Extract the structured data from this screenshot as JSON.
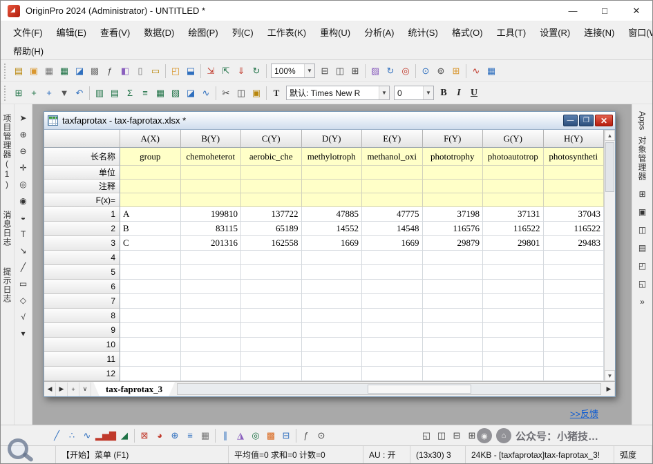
{
  "window": {
    "title": "OriginPro 2024 (Administrator) - UNTITLED *",
    "controls": {
      "minimize": "—",
      "maximize": "□",
      "close": "✕"
    }
  },
  "menubar": {
    "row1": [
      "文件(F)",
      "编辑(E)",
      "查看(V)",
      "数据(D)",
      "绘图(P)",
      "列(C)",
      "工作表(K)",
      "重构(U)",
      "分析(A)",
      "统计(S)",
      "格式(O)",
      "工具(T)",
      "设置(R)",
      "连接(N)",
      "窗口(W)"
    ],
    "row2": [
      "帮助(H)"
    ]
  },
  "toolbar": {
    "zoom": "100%",
    "font_tool": "T",
    "font_label": "默认: Times New R",
    "font_size": "0",
    "bold": "B",
    "italic": "I",
    "underline": "U",
    "dropdown_arrow": "▼"
  },
  "toolbar_icons": {
    "row1a": [
      {
        "n": "new-project",
        "g": "▤",
        "c": "#b8860b"
      },
      {
        "n": "new-folder",
        "g": "▣",
        "c": "#d9972f"
      },
      {
        "n": "new-workbook",
        "g": "▦",
        "c": "#777777"
      },
      {
        "n": "new-excel",
        "g": "▦",
        "c": "#1e7145"
      },
      {
        "n": "new-graph",
        "g": "◪",
        "c": "#2f6fbe"
      },
      {
        "n": "new-matrix",
        "g": "▩",
        "c": "#777777"
      },
      {
        "n": "new-function-plot",
        "g": "ƒ",
        "c": "#555555"
      },
      {
        "n": "new-3d-graph",
        "g": "◧",
        "c": "#8a5fbe"
      },
      {
        "n": "new-layout",
        "g": "▯",
        "c": "#777777"
      },
      {
        "n": "new-notes",
        "g": "▭",
        "c": "#b8860b"
      },
      "|",
      {
        "n": "open",
        "g": "◰",
        "c": "#d9972f"
      },
      {
        "n": "save-project",
        "g": "⬓",
        "c": "#2f6fbe"
      },
      "|",
      {
        "n": "import-wizard",
        "g": "⇲",
        "c": "#c0392b"
      },
      {
        "n": "import-excel",
        "g": "⇱",
        "c": "#1e7145"
      },
      {
        "n": "import-ascii",
        "g": "⇓",
        "c": "#c0392b"
      },
      {
        "n": "recalculate",
        "g": "↻",
        "c": "#1e7145"
      },
      "|"
    ],
    "row1b": [
      {
        "n": "print",
        "g": "⊟",
        "c": "#444444"
      },
      {
        "n": "copy-graph",
        "g": "◫",
        "c": "#444444"
      },
      {
        "n": "duplicate-window",
        "g": "⊞",
        "c": "#444444"
      },
      "|",
      {
        "n": "color-manager",
        "g": "▨",
        "c": "#8a5fbe"
      },
      {
        "n": "refresh-graph",
        "g": "↻",
        "c": "#2f6fbe"
      },
      {
        "n": "snap-center",
        "g": "◎",
        "c": "#c0392b"
      },
      "|",
      {
        "n": "find",
        "g": "⊙",
        "c": "#2f6fbe"
      },
      {
        "n": "search-apps",
        "g": "⊚",
        "c": "#444444"
      },
      {
        "n": "app-center",
        "g": "⊞",
        "c": "#d9972f"
      },
      "|",
      {
        "n": "fitting-gallery",
        "g": "∿",
        "c": "#c0392b"
      },
      {
        "n": "graph-gallery",
        "g": "▦",
        "c": "#2f6fbe"
      }
    ],
    "row2a": [
      {
        "n": "add-workbook",
        "g": "⊞",
        "c": "#1e7145"
      },
      {
        "n": "add-columns",
        "g": "+",
        "c": "#1e7145"
      },
      {
        "n": "add-rows",
        "g": "+",
        "c": "#2f6fbe"
      },
      {
        "n": "pin-window",
        "g": "▼",
        "c": "#555555"
      },
      {
        "n": "undo",
        "g": "↶",
        "c": "#2f6fbe"
      },
      "|",
      {
        "n": "merge-cells",
        "g": "▥",
        "c": "#1e7145"
      },
      {
        "n": "set-values",
        "g": "▤",
        "c": "#1e7145"
      },
      {
        "n": "column-statistics",
        "g": "Σ",
        "c": "#1e7145"
      },
      {
        "n": "sort",
        "g": "≡",
        "c": "#1e7145"
      },
      {
        "n": "pivot-table",
        "g": "▦",
        "c": "#1e7145"
      },
      {
        "n": "freeze-panes",
        "g": "▧",
        "c": "#1e7145"
      },
      {
        "n": "insert-graph",
        "g": "◪",
        "c": "#2f6fbe"
      },
      {
        "n": "insert-sparkline",
        "g": "∿",
        "c": "#2f6fbe"
      },
      "|",
      {
        "n": "cut",
        "g": "✂",
        "c": "#444444"
      },
      {
        "n": "copy",
        "g": "◫",
        "c": "#444444"
      },
      {
        "n": "paste",
        "g": "▣",
        "c": "#b8860b"
      },
      "|"
    ]
  },
  "left_tabs": [
    "项目管理器(1)",
    "消息日志",
    "提示日志"
  ],
  "left_tools": [
    {
      "n": "pointer-tool",
      "g": "➤"
    },
    {
      "n": "zoom-in-tool",
      "g": "⊕"
    },
    {
      "n": "zoom-out-tool",
      "g": "⊖"
    },
    {
      "n": "screen-reader-tool",
      "g": "✛"
    },
    {
      "n": "data-reader-tool",
      "g": "◎"
    },
    {
      "n": "data-selector-tool",
      "g": "◉"
    },
    {
      "n": "mask-tool",
      "g": "◒"
    },
    {
      "n": "text-tool",
      "g": "T"
    },
    {
      "n": "arrow-tool",
      "g": "↘"
    },
    {
      "n": "line-tool",
      "g": "╱"
    },
    {
      "n": "rectangle-tool",
      "g": "▭"
    },
    {
      "n": "pan-tool",
      "g": "◇"
    },
    {
      "n": "equation-tool",
      "g": "√"
    },
    {
      "n": "more-tools",
      "g": "▾"
    }
  ],
  "right_panel": {
    "apps_label": "Apps",
    "object_manager_label": "对象管理器",
    "icons": [
      {
        "n": "apps-grid",
        "g": "⊞"
      },
      {
        "n": "mini-toolbar",
        "g": "▣"
      },
      {
        "n": "graph-browser",
        "g": "◫"
      },
      {
        "n": "worksheet-navigator",
        "g": "▤"
      },
      {
        "n": "float-panel",
        "g": "◰"
      },
      {
        "n": "dock-panel",
        "g": "◱"
      },
      {
        "n": "collapse-panel",
        "g": "»"
      }
    ]
  },
  "sheet": {
    "title": "taxfaprotax - tax-faprotax.xlsx *",
    "controls": {
      "minimize": "—",
      "restore": "❐",
      "close": "✕"
    },
    "columns": [
      "A(X)",
      "B(Y)",
      "C(Y)",
      "D(Y)",
      "E(Y)",
      "F(Y)",
      "G(Y)",
      "H(Y)"
    ],
    "label_rows": [
      {
        "label": "长名称",
        "values": [
          "group",
          "chemoheterot",
          "aerobic_che",
          "methylotroph",
          "methanol_oxi",
          "phototrophy",
          "photoautotrop",
          "photosyntheti"
        ]
      },
      {
        "label": "单位",
        "values": []
      },
      {
        "label": "注释",
        "values": []
      },
      {
        "label": "F(x)=",
        "values": []
      }
    ],
    "rows": [
      {
        "n": "1",
        "values": [
          "A",
          "199810",
          "137722",
          "47885",
          "47775",
          "37198",
          "37131",
          "37043"
        ]
      },
      {
        "n": "2",
        "values": [
          "B",
          "83115",
          "65189",
          "14552",
          "14548",
          "116576",
          "116522",
          "116522"
        ]
      },
      {
        "n": "3",
        "values": [
          "C",
          "201316",
          "162558",
          "1669",
          "1669",
          "29879",
          "29801",
          "29483"
        ]
      },
      {
        "n": "4",
        "values": []
      },
      {
        "n": "5",
        "values": []
      },
      {
        "n": "6",
        "values": []
      },
      {
        "n": "7",
        "values": []
      },
      {
        "n": "8",
        "values": []
      },
      {
        "n": "9",
        "values": []
      },
      {
        "n": "10",
        "values": []
      },
      {
        "n": "11",
        "values": []
      },
      {
        "n": "12",
        "values": []
      }
    ],
    "nav": [
      {
        "n": "prev-sheet",
        "g": "◀"
      },
      {
        "n": "next-sheet",
        "g": "▶"
      },
      {
        "n": "add-sheet",
        "g": "+"
      },
      {
        "n": "sheet-list",
        "g": "∨"
      }
    ],
    "tab": "tax-faprotax_3",
    "scroll_up": "▲",
    "scroll_down": "▼",
    "scroll_right": "▶"
  },
  "feedback": ">>反馈",
  "plot_toolbar": {
    "icons": [
      {
        "n": "line-plot",
        "g": "╱",
        "c": "#2f6fbe"
      },
      {
        "n": "scatter-plot",
        "g": "∴",
        "c": "#2f6fbe"
      },
      {
        "n": "line-symbol-plot",
        "g": "∿",
        "c": "#2f6fbe"
      },
      {
        "n": "column-plot",
        "g": "▂▅▇",
        "c": "#c0392b"
      },
      {
        "n": "area-plot",
        "g": "◢",
        "c": "#1e7145"
      },
      "|",
      {
        "n": "template-library",
        "g": "⊠",
        "c": "#c0392b"
      },
      {
        "n": "pie-chart",
        "g": "◕",
        "c": "#c0392b"
      },
      {
        "n": "polar-plot",
        "g": "⊕",
        "c": "#2f6fbe"
      },
      {
        "n": "stacked-plot",
        "g": "≡",
        "c": "#2f6fbe"
      },
      {
        "n": "worksheet-plot",
        "g": "▦",
        "c": "#777777"
      },
      "|",
      {
        "n": "multi-y-plot",
        "g": "∥",
        "c": "#2f6fbe"
      },
      {
        "n": "3d-plot",
        "g": "◮",
        "c": "#8a5fbe"
      },
      {
        "n": "contour-plot",
        "g": "◎",
        "c": "#1e7145"
      },
      {
        "n": "heatmap-plot",
        "g": "▩",
        "c": "#d9681e"
      },
      {
        "n": "box-chart",
        "g": "⊟",
        "c": "#2f6fbe"
      },
      "|",
      {
        "n": "fit-tool",
        "g": "ƒ",
        "c": "#555555"
      },
      {
        "n": "zoom-all",
        "g": "⊙",
        "c": "#444444"
      }
    ],
    "right_icons": [
      {
        "n": "new-graph-window",
        "g": "◱",
        "c": "#444444"
      },
      {
        "n": "cascade-windows",
        "g": "◫",
        "c": "#444444"
      },
      {
        "n": "tile-horizontal",
        "g": "⊟",
        "c": "#444444"
      },
      {
        "n": "tile-vertical",
        "g": "⊞",
        "c": "#444444"
      }
    ]
  },
  "statusbar": {
    "start": "【开始】菜单 (F1)",
    "stats": "平均值=0 求和=0 计数=0",
    "au": "AU : 开",
    "dims": "(13x30) 3",
    "file": "24KB - [taxfaprotax]tax-faprotax_3!",
    "angle": "弧度"
  },
  "watermark": {
    "badges": [
      "◉",
      "⌂"
    ],
    "text": "公众号：小猪技…"
  }
}
